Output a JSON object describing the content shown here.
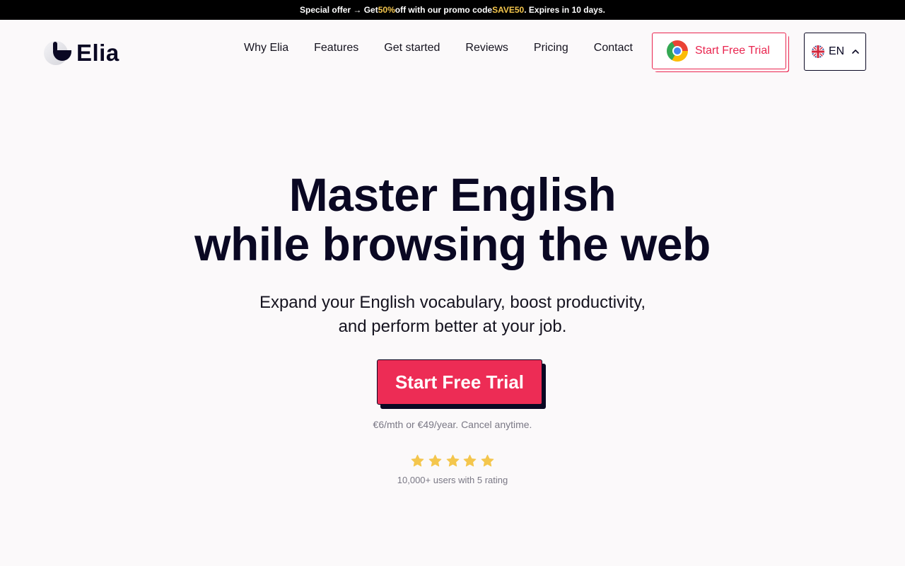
{
  "promo": {
    "text_before": "Special offer → Get ",
    "discount": "50%",
    "text_middle": " off with our promo code ",
    "code": "SAVE50",
    "text_after": ". Expires in 10 days."
  },
  "brand": {
    "name": "Elia"
  },
  "nav": {
    "items": [
      {
        "label": "Why Elia"
      },
      {
        "label": "Features"
      },
      {
        "label": "Get started"
      },
      {
        "label": "Reviews"
      },
      {
        "label": "Pricing"
      },
      {
        "label": "Contact"
      }
    ],
    "trial_button": {
      "label": "Start Free Trial",
      "icon": "chrome-icon"
    },
    "language": {
      "code": "EN",
      "icon": "uk-flag-icon",
      "chevron": "chevron-up-icon"
    }
  },
  "hero": {
    "title_line1": "Master English",
    "title_line2": "while browsing the web",
    "subtitle_line1": "Expand your English vocabulary, boost productivity,",
    "subtitle_line2": "and perform better at your job.",
    "cta_label": "Start Free Trial",
    "price_note": "€6/mth or €49/year. Cancel anytime.",
    "rating": {
      "stars": 5,
      "max": 5
    },
    "rating_note": "10,000+ users with 5 rating"
  },
  "colors": {
    "accent": "#ed2c55",
    "dark": "#0a0823",
    "star": "#f4c64d",
    "background": "#fbf9fa"
  }
}
